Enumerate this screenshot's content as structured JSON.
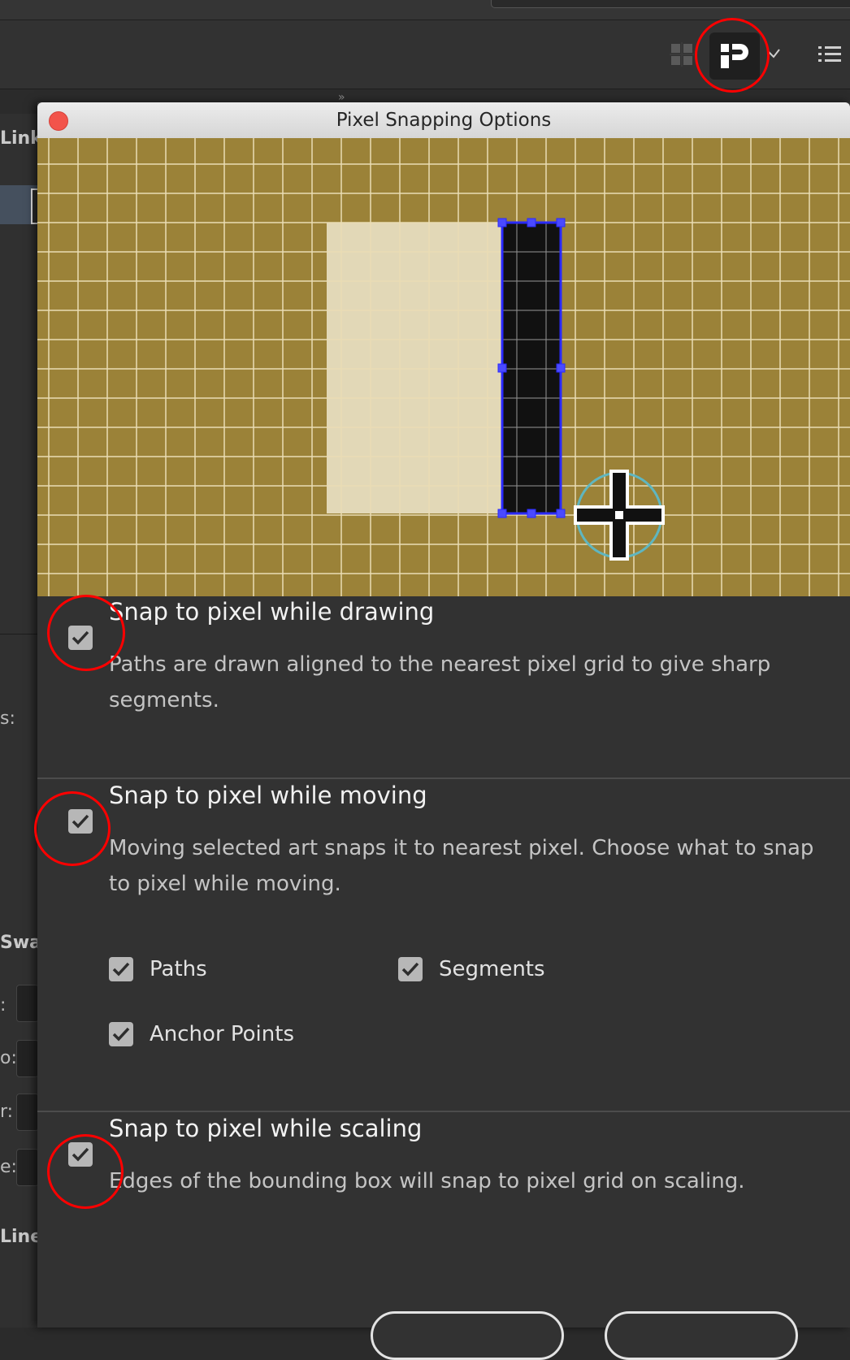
{
  "dialog": {
    "title": "Pixel Snapping Options",
    "close_label": "close",
    "options": {
      "drawing": {
        "title": "Snap to pixel while drawing",
        "description": "Paths are drawn aligned to the nearest pixel grid to give sharp segments.",
        "checked": true
      },
      "moving": {
        "title": "Snap to pixel while moving",
        "description": "Moving selected art snaps it to nearest pixel. Choose what to snap to pixel while moving.",
        "checked": true,
        "sub_options": {
          "paths": {
            "label": "Paths",
            "checked": true
          },
          "segments": {
            "label": "Segments",
            "checked": true
          },
          "anchor_points": {
            "label": "Anchor Points",
            "checked": true
          }
        }
      },
      "scaling": {
        "title": "Snap to pixel while scaling",
        "description": "Edges of the bounding box will snap to pixel grid on scaling.",
        "checked": true
      }
    }
  },
  "left_panel": {
    "link": "Link",
    "s_colon": "s:",
    "swa": "Swa",
    "colon1": ":",
    "colon2": "o:",
    "colon3": "r:",
    "colon4": "e:",
    "line": "Line"
  },
  "colors": {
    "canvas": "#9b8238",
    "close": "#f2544b",
    "annotation": "#ff0000",
    "selection": "#2a2aff"
  },
  "icons": {
    "toolbar": [
      "grid-icon",
      "snap-to-pixel-icon",
      "chevron-down-icon",
      "list-menu-icon"
    ],
    "preview": [
      "crosshair-cursor-icon"
    ],
    "checkbox": "checkmark-icon"
  }
}
